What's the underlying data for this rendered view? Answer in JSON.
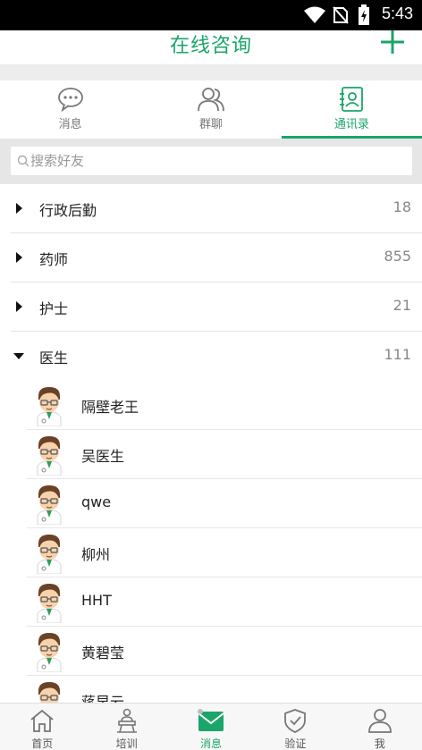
{
  "status_bar": {
    "time": "5:43"
  },
  "header": {
    "title": "在线咨询"
  },
  "tabs": [
    {
      "label": "消息",
      "icon": "chat-bubble-icon",
      "active": false
    },
    {
      "label": "群聊",
      "icon": "group-icon",
      "active": false
    },
    {
      "label": "通讯录",
      "icon": "contacts-icon",
      "active": true
    }
  ],
  "search": {
    "placeholder": "搜索好友",
    "value": ""
  },
  "groups": [
    {
      "name": "行政后勤",
      "count": "18",
      "expanded": false
    },
    {
      "name": "药师",
      "count": "855",
      "expanded": false
    },
    {
      "name": "护士",
      "count": "21",
      "expanded": false
    },
    {
      "name": "医生",
      "count": "111",
      "expanded": true
    }
  ],
  "members": [
    "隔壁老王",
    "吴医生",
    "qwe",
    "柳州",
    "HHT",
    "黄碧莹",
    "蒋早云"
  ],
  "bottom_nav": [
    {
      "label": "首页",
      "icon": "home-icon",
      "active": false
    },
    {
      "label": "培训",
      "icon": "training-icon",
      "active": false
    },
    {
      "label": "消息",
      "icon": "message-envelope-icon",
      "active": true
    },
    {
      "label": "验证",
      "icon": "shield-check-icon",
      "active": false
    },
    {
      "label": "我",
      "icon": "user-icon",
      "active": false
    }
  ],
  "colors": {
    "accent": "#1aa56a",
    "status_bar": "#000000"
  }
}
